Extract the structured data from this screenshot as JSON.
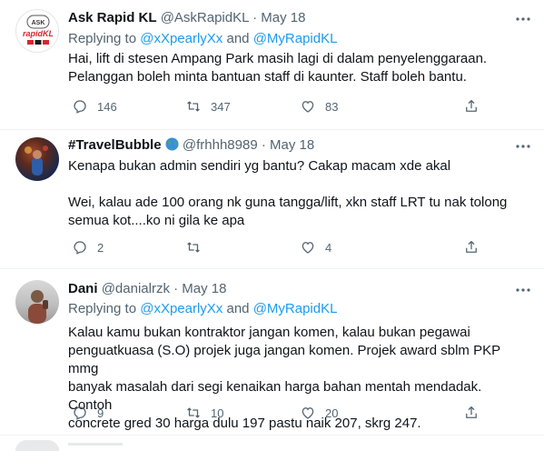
{
  "tweets": [
    {
      "name": "Ask Rapid KL",
      "handle": "@AskRapidKL",
      "dot": "·",
      "date": "May 18",
      "replying_prefix": "Replying to ",
      "mention1": "@xXpearlyXx",
      "and": " and ",
      "mention2": "@MyRapidKL",
      "text_lines": [
        "Hai, lift di stesen Ampang Park masih lagi di dalam penyelenggaraan.",
        "Pelanggan boleh minta bantuan staff di kaunter. Staff boleh bantu."
      ],
      "replies": "146",
      "retweets": "347",
      "likes": "83",
      "avatar_logo_top": "ASK",
      "avatar_logo_mid": "rapidKL"
    },
    {
      "name": "#TravelBubble",
      "handle": "@frhhh8989",
      "dot": "·",
      "date": "May 18",
      "text_lines": [
        "Kenapa bukan admin sendiri yg bantu? Cakap macam xde akal",
        "",
        "Wei, kalau ade 100 orang nk guna tangga/lift, xkn staff LRT tu nak tolong",
        "semua kot....ko ni gila ke apa"
      ],
      "replies": "2",
      "retweets": "",
      "likes": "4"
    },
    {
      "name": "Dani",
      "handle": "@danialrzk",
      "dot": "·",
      "date": "May 18",
      "replying_prefix": "Replying to ",
      "mention1": "@xXpearlyXx",
      "and": " and ",
      "mention2": "@MyRapidKL",
      "text_lines": [
        "Kalau kamu bukan kontraktor jangan komen, kalau bukan pegawai",
        "penguatkuasa (S.O) projek juga jangan komen. Projek award sblm PKP mmg",
        "banyak masalah dari segi kenaikan harga bahan mentah mendadak. Contoh",
        "concrete gred 30 harga dulu 197 pastu naik 207, skrg 247."
      ],
      "replies": "9",
      "retweets": "10",
      "likes": "20"
    }
  ],
  "colors": {
    "link": "#1d9bf0",
    "muted": "#536471",
    "text": "#0f1419",
    "divider": "#eff3f4"
  }
}
